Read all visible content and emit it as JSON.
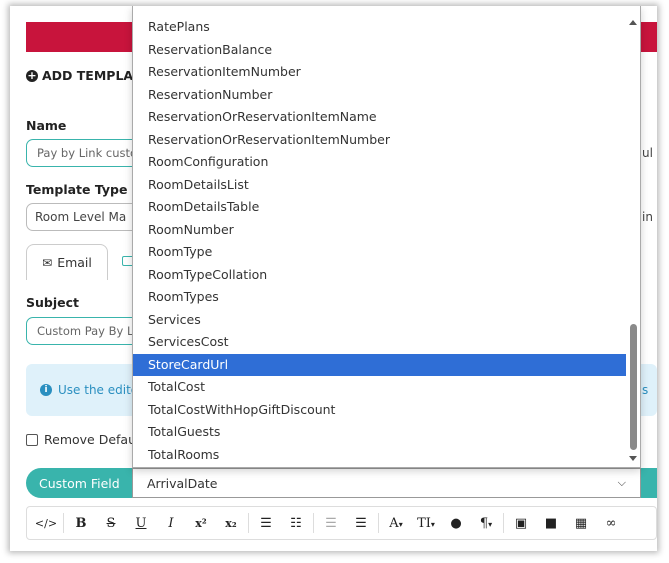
{
  "form": {
    "add_template": "ADD TEMPLAT",
    "name_label": "Name",
    "name_value": "Pay by Link custo",
    "template_type_label": "Template Type",
    "template_type_value": "Room Level Ma",
    "email_tab": "Email",
    "subject_label": "Subject",
    "subject_value": "Custom Pay By L",
    "info_text": "Use the edito",
    "remove_default": "Remove Defau",
    "right_fragment_1": "ul",
    "right_fragment_2": "in",
    "right_fragment_3": "s"
  },
  "custom_field": {
    "button_label": "Custom Field",
    "selected_value": "ArrivalDate"
  },
  "dropdown": {
    "options": [
      "RatePlans",
      "ReservationBalance",
      "ReservationItemNumber",
      "ReservationNumber",
      "ReservationOrReservationItemName",
      "ReservationOrReservationItemNumber",
      "RoomConfiguration",
      "RoomDetailsList",
      "RoomDetailsTable",
      "RoomNumber",
      "RoomType",
      "RoomTypeCollation",
      "RoomTypes",
      "Services",
      "ServicesCost",
      "StoreCardUrl",
      "TotalCost",
      "TotalCostWithHopGiftDiscount",
      "TotalGuests",
      "TotalRooms"
    ],
    "highlighted": "StoreCardUrl"
  },
  "toolbar": {
    "code": "</>",
    "bold": "B",
    "strike": "S",
    "underline": "U",
    "italic": "I",
    "superscript": "x²",
    "subscript": "x₂",
    "font_size": "A",
    "text_size": "TI",
    "paragraph": "¶"
  },
  "colors": {
    "accent": "#39b4ac",
    "brand_red": "#c8143c",
    "highlight": "#2f6ed6",
    "info_bg": "#dff1fa"
  }
}
